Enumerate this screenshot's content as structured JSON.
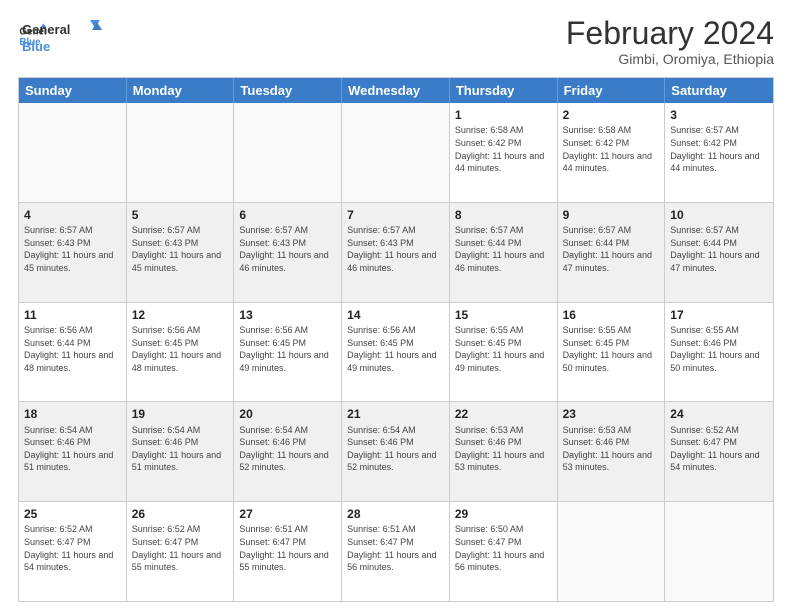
{
  "logo": {
    "line1": "General",
    "line2": "Blue"
  },
  "title": "February 2024",
  "subtitle": "Gimbi, Oromiya, Ethiopia",
  "weekdays": [
    "Sunday",
    "Monday",
    "Tuesday",
    "Wednesday",
    "Thursday",
    "Friday",
    "Saturday"
  ],
  "rows": [
    [
      {
        "day": "",
        "info": ""
      },
      {
        "day": "",
        "info": ""
      },
      {
        "day": "",
        "info": ""
      },
      {
        "day": "",
        "info": ""
      },
      {
        "day": "1",
        "info": "Sunrise: 6:58 AM\nSunset: 6:42 PM\nDaylight: 11 hours and 44 minutes."
      },
      {
        "day": "2",
        "info": "Sunrise: 6:58 AM\nSunset: 6:42 PM\nDaylight: 11 hours and 44 minutes."
      },
      {
        "day": "3",
        "info": "Sunrise: 6:57 AM\nSunset: 6:42 PM\nDaylight: 11 hours and 44 minutes."
      }
    ],
    [
      {
        "day": "4",
        "info": "Sunrise: 6:57 AM\nSunset: 6:43 PM\nDaylight: 11 hours and 45 minutes."
      },
      {
        "day": "5",
        "info": "Sunrise: 6:57 AM\nSunset: 6:43 PM\nDaylight: 11 hours and 45 minutes."
      },
      {
        "day": "6",
        "info": "Sunrise: 6:57 AM\nSunset: 6:43 PM\nDaylight: 11 hours and 46 minutes."
      },
      {
        "day": "7",
        "info": "Sunrise: 6:57 AM\nSunset: 6:43 PM\nDaylight: 11 hours and 46 minutes."
      },
      {
        "day": "8",
        "info": "Sunrise: 6:57 AM\nSunset: 6:44 PM\nDaylight: 11 hours and 46 minutes."
      },
      {
        "day": "9",
        "info": "Sunrise: 6:57 AM\nSunset: 6:44 PM\nDaylight: 11 hours and 47 minutes."
      },
      {
        "day": "10",
        "info": "Sunrise: 6:57 AM\nSunset: 6:44 PM\nDaylight: 11 hours and 47 minutes."
      }
    ],
    [
      {
        "day": "11",
        "info": "Sunrise: 6:56 AM\nSunset: 6:44 PM\nDaylight: 11 hours and 48 minutes."
      },
      {
        "day": "12",
        "info": "Sunrise: 6:56 AM\nSunset: 6:45 PM\nDaylight: 11 hours and 48 minutes."
      },
      {
        "day": "13",
        "info": "Sunrise: 6:56 AM\nSunset: 6:45 PM\nDaylight: 11 hours and 49 minutes."
      },
      {
        "day": "14",
        "info": "Sunrise: 6:56 AM\nSunset: 6:45 PM\nDaylight: 11 hours and 49 minutes."
      },
      {
        "day": "15",
        "info": "Sunrise: 6:55 AM\nSunset: 6:45 PM\nDaylight: 11 hours and 49 minutes."
      },
      {
        "day": "16",
        "info": "Sunrise: 6:55 AM\nSunset: 6:45 PM\nDaylight: 11 hours and 50 minutes."
      },
      {
        "day": "17",
        "info": "Sunrise: 6:55 AM\nSunset: 6:46 PM\nDaylight: 11 hours and 50 minutes."
      }
    ],
    [
      {
        "day": "18",
        "info": "Sunrise: 6:54 AM\nSunset: 6:46 PM\nDaylight: 11 hours and 51 minutes."
      },
      {
        "day": "19",
        "info": "Sunrise: 6:54 AM\nSunset: 6:46 PM\nDaylight: 11 hours and 51 minutes."
      },
      {
        "day": "20",
        "info": "Sunrise: 6:54 AM\nSunset: 6:46 PM\nDaylight: 11 hours and 52 minutes."
      },
      {
        "day": "21",
        "info": "Sunrise: 6:54 AM\nSunset: 6:46 PM\nDaylight: 11 hours and 52 minutes."
      },
      {
        "day": "22",
        "info": "Sunrise: 6:53 AM\nSunset: 6:46 PM\nDaylight: 11 hours and 53 minutes."
      },
      {
        "day": "23",
        "info": "Sunrise: 6:53 AM\nSunset: 6:46 PM\nDaylight: 11 hours and 53 minutes."
      },
      {
        "day": "24",
        "info": "Sunrise: 6:52 AM\nSunset: 6:47 PM\nDaylight: 11 hours and 54 minutes."
      }
    ],
    [
      {
        "day": "25",
        "info": "Sunrise: 6:52 AM\nSunset: 6:47 PM\nDaylight: 11 hours and 54 minutes."
      },
      {
        "day": "26",
        "info": "Sunrise: 6:52 AM\nSunset: 6:47 PM\nDaylight: 11 hours and 55 minutes."
      },
      {
        "day": "27",
        "info": "Sunrise: 6:51 AM\nSunset: 6:47 PM\nDaylight: 11 hours and 55 minutes."
      },
      {
        "day": "28",
        "info": "Sunrise: 6:51 AM\nSunset: 6:47 PM\nDaylight: 11 hours and 56 minutes."
      },
      {
        "day": "29",
        "info": "Sunrise: 6:50 AM\nSunset: 6:47 PM\nDaylight: 11 hours and 56 minutes."
      },
      {
        "day": "",
        "info": ""
      },
      {
        "day": "",
        "info": ""
      }
    ]
  ]
}
